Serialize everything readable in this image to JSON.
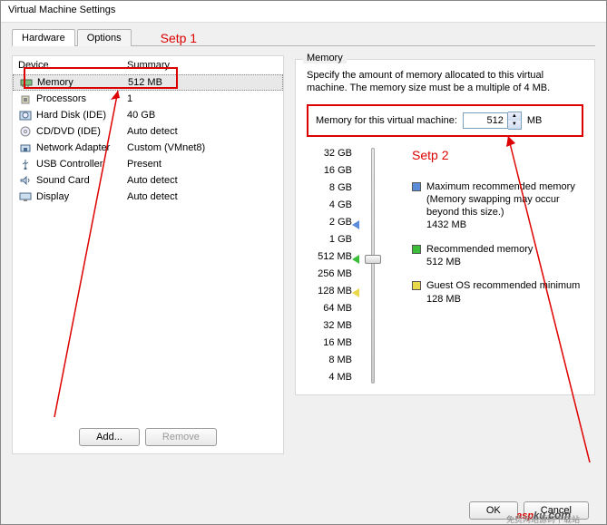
{
  "window": {
    "title": "Virtual Machine Settings"
  },
  "tabs": {
    "hardware": "Hardware",
    "options": "Options"
  },
  "annotations": {
    "step1": "Setp 1",
    "step2": "Setp 2"
  },
  "columns": {
    "device": "Device",
    "summary": "Summary"
  },
  "devices": [
    {
      "name": "Memory",
      "summary": "512 MB",
      "icon": "memory-icon",
      "selected": true
    },
    {
      "name": "Processors",
      "summary": "1",
      "icon": "cpu-icon"
    },
    {
      "name": "Hard Disk (IDE)",
      "summary": "40 GB",
      "icon": "hdd-icon"
    },
    {
      "name": "CD/DVD (IDE)",
      "summary": "Auto detect",
      "icon": "cd-icon"
    },
    {
      "name": "Network Adapter",
      "summary": "Custom (VMnet8)",
      "icon": "nic-icon"
    },
    {
      "name": "USB Controller",
      "summary": "Present",
      "icon": "usb-icon"
    },
    {
      "name": "Sound Card",
      "summary": "Auto detect",
      "icon": "sound-icon"
    },
    {
      "name": "Display",
      "summary": "Auto detect",
      "icon": "display-icon"
    }
  ],
  "buttons": {
    "add": "Add...",
    "remove": "Remove",
    "ok": "OK",
    "cancel": "Cancel"
  },
  "memory": {
    "group_title": "Memory",
    "desc": "Specify the amount of memory allocated to this virtual machine. The memory size must be a multiple of 4 MB.",
    "input_label": "Memory for this virtual machine:",
    "value": "512",
    "unit": "MB",
    "scale": [
      "32 GB",
      "16 GB",
      "8 GB",
      "4 GB",
      "2 GB",
      "1 GB",
      "512 MB",
      "256 MB",
      "128 MB",
      "64 MB",
      "32 MB",
      "16 MB",
      "8 MB",
      "4 MB"
    ],
    "legend": {
      "max": {
        "title": "Maximum recommended memory",
        "note": "(Memory swapping may occur beyond this size.)",
        "value": "1432 MB",
        "color": "#5a8cd8"
      },
      "rec": {
        "title": "Recommended memory",
        "value": "512 MB",
        "color": "#3bbf3b"
      },
      "min": {
        "title": "Guest OS recommended minimum",
        "value": "128 MB",
        "color": "#e8d84a"
      }
    }
  },
  "watermark": {
    "brand_a": "asp",
    "brand_b": "ku",
    "tld": ".com",
    "sub": "免费网站源码下载站"
  }
}
